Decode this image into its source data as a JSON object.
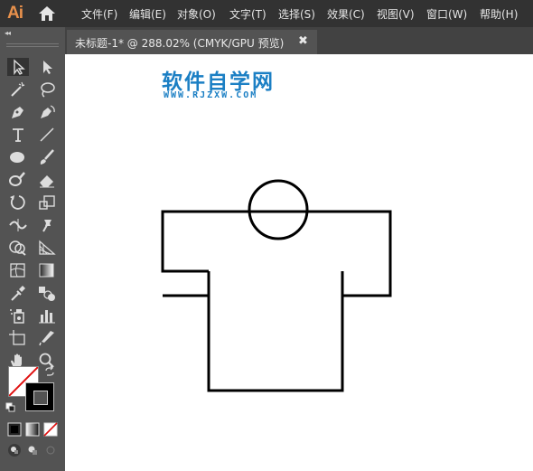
{
  "app": {
    "logo": "Ai"
  },
  "menu": [
    "文件(F)",
    "编辑(E)",
    "对象(O)",
    "文字(T)",
    "选择(S)",
    "效果(C)",
    "视图(V)",
    "窗口(W)",
    "帮助(H)"
  ],
  "document_tab": {
    "title": "未标题-1* @ 288.02% (CMYK/GPU 预览)",
    "close": "✖"
  },
  "collapse_glyph": "◂◂",
  "watermark": {
    "main": "软件自学网",
    "url": "WWW.RJZXW.COM"
  },
  "colors": {
    "menubar": "#323232",
    "panel": "#535353",
    "tabbar": "#424242",
    "accent": "#e8914c",
    "watermark": "#1b7fc4"
  },
  "tools": [
    "selection-tool-icon",
    "direct-selection-tool-icon",
    "magic-wand-tool-icon",
    "lasso-tool-icon",
    "pen-tool-icon",
    "curvature-tool-icon",
    "type-tool-icon",
    "line-segment-tool-icon",
    "ellipse-tool-icon",
    "paintbrush-tool-icon",
    "blob-brush-tool-icon",
    "eraser-tool-icon",
    "rotate-tool-icon",
    "scale-tool-icon",
    "width-tool-icon",
    "puppet-warp-tool-icon",
    "shape-builder-tool-icon",
    "perspective-grid-tool-icon",
    "mesh-tool-icon",
    "gradient-tool-icon",
    "eyedropper-tool-icon",
    "blend-tool-icon",
    "symbol-sprayer-tool-icon",
    "column-graph-tool-icon",
    "artboard-tool-icon",
    "slice-tool-icon",
    "hand-tool-icon",
    "zoom-tool-icon"
  ]
}
